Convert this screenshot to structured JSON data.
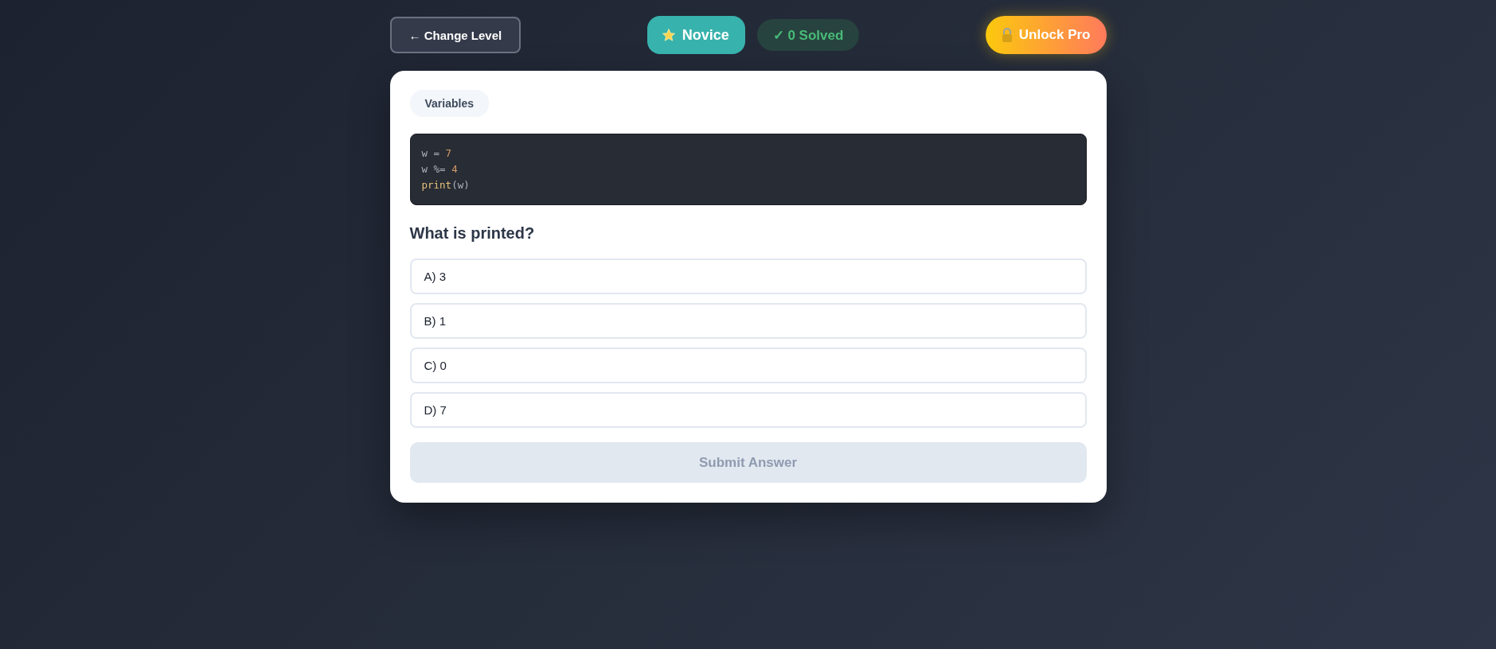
{
  "header": {
    "back_button": "← Change Level",
    "level_badge": {
      "label": "Novice"
    },
    "solved_badge": "✓ 0 Solved",
    "upgrade_button": "Unlock Pro"
  },
  "card": {
    "topic_tag": "Variables",
    "code": [
      [
        {
          "text": "w = ",
          "kind": "plain"
        },
        {
          "text": "7",
          "kind": "number"
        }
      ],
      [
        {
          "text": "w %= ",
          "kind": "plain"
        },
        {
          "text": "4",
          "kind": "number"
        }
      ],
      [
        {
          "text": "print",
          "kind": "builtin"
        },
        {
          "text": "(w)",
          "kind": "plain"
        }
      ]
    ],
    "question": "What is printed?",
    "options": [
      {
        "label": "A) 3",
        "selected": false
      },
      {
        "label": "B) 1",
        "selected": false
      },
      {
        "label": "C) 0",
        "selected": false
      },
      {
        "label": "D) 7",
        "selected": false
      }
    ],
    "submit": {
      "label": "Submit Answer",
      "disabled": true
    }
  }
}
